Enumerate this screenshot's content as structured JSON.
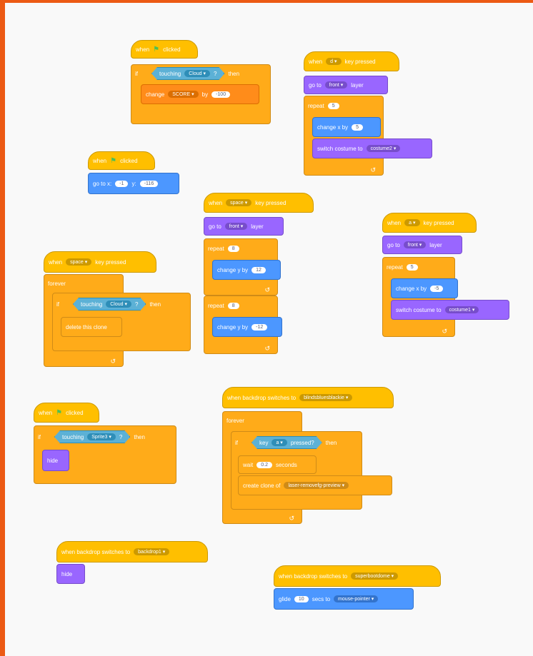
{
  "colors": {
    "frame": "#ec5a14",
    "events": "#ffbf00",
    "control": "#ffab19",
    "motion": "#4c97ff",
    "looks": "#9966ff",
    "variables": "#ff8c1a",
    "sensing": "#5cb1d6"
  },
  "icons": {
    "flag": "green-flag-icon",
    "dropdown": "caret-down-icon",
    "loop": "loop-arrow-icon"
  },
  "s1": {
    "when": "when",
    "clicked": "clicked",
    "if": "if",
    "touching": "touching",
    "target": "Cloud",
    "q": "?",
    "then": "then",
    "change": "change",
    "var": "SCORE",
    "by": "by",
    "val": "-100"
  },
  "s2": {
    "when": "when",
    "key": "d",
    "pressed": "key pressed",
    "goto": "go to",
    "layer": "front",
    "layer_word": "layer",
    "repeat": "repeat",
    "times": "5",
    "changex": "change x by",
    "dx": "5",
    "switch": "switch costume to",
    "costume": "costume2"
  },
  "s3": {
    "when": "when",
    "clicked": "clicked",
    "goto": "go to x:",
    "x": "-1",
    "y_label": "y:",
    "y": "-116"
  },
  "s4": {
    "when": "when",
    "key": "space",
    "pressed": "key pressed",
    "goto": "go to",
    "layer": "front",
    "layer_word": "layer",
    "repeat1": "repeat",
    "times1": "8",
    "changey1": "change y by",
    "dy1": "12",
    "repeat2": "repeat",
    "times2": "8",
    "changey2": "change y by",
    "dy2": "-12"
  },
  "s5": {
    "when": "when",
    "key": "a",
    "pressed": "key pressed",
    "goto": "go to",
    "layer": "front",
    "layer_word": "layer",
    "repeat": "repeat",
    "times": "5",
    "changex": "change x by",
    "dx": "-5",
    "switch": "switch costume to",
    "costume": "costume1"
  },
  "s6": {
    "when": "when",
    "key": "space",
    "pressed": "key pressed",
    "forever": "forever",
    "if": "if",
    "touching": "touching",
    "target": "Cloud",
    "q": "?",
    "then": "then",
    "delete": "delete this clone"
  },
  "s7": {
    "when": "when",
    "clicked": "clicked",
    "if": "if",
    "touching": "touching",
    "target": "Sprite3",
    "q": "?",
    "then": "then",
    "hide": "hide"
  },
  "s8": {
    "when": "when backdrop switches to",
    "backdrop": "blindsbluesblackie",
    "forever": "forever",
    "if": "if",
    "key": "key",
    "keyname": "a",
    "pressed": "pressed?",
    "then": "then",
    "wait": "wait",
    "secs": "0.2",
    "seconds": "seconds",
    "create": "create clone of",
    "clone": "laser-removefg-preview"
  },
  "s9": {
    "when": "when backdrop switches to",
    "backdrop": "backdrop1",
    "hide": "hide"
  },
  "s10": {
    "when": "when backdrop switches to",
    "backdrop": "superbootdome",
    "glide": "glide",
    "secs": "10",
    "secs_to": "secs to",
    "target": "mouse-pointer"
  }
}
